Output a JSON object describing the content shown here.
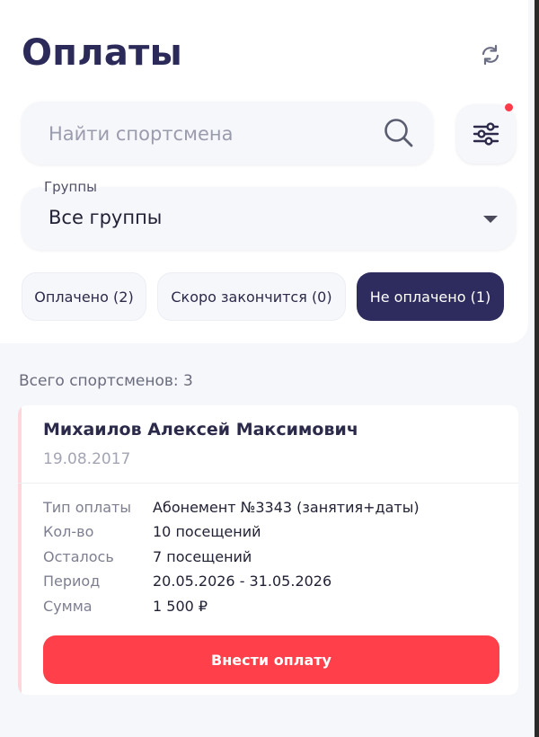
{
  "header": {
    "title": "Оплаты",
    "refresh_icon": "refresh-icon"
  },
  "search": {
    "placeholder": "Найти спортсмена",
    "value": "",
    "icon": "search-icon"
  },
  "filter_button": {
    "icon": "sliders-icon",
    "has_badge": true,
    "badge_color": "#ff3b4a"
  },
  "groups": {
    "label": "Группы",
    "selected": "Все группы"
  },
  "status_tabs": [
    {
      "label": "Оплачено (2)",
      "active": false
    },
    {
      "label": "Скоро закончится (0)",
      "active": false
    },
    {
      "label": "Не оплачено (1)",
      "active": true
    }
  ],
  "summary": {
    "total_text": "Всего спортсменов: 3"
  },
  "athlete_card": {
    "name": "Михаилов Алексей Максимович",
    "birth_date": "19.08.2017",
    "details": [
      {
        "label": "Тип оплаты",
        "value": "Абонемент №3343 (занятия+даты)"
      },
      {
        "label": "Кол-во",
        "value": "10 посещений"
      },
      {
        "label": "Осталось",
        "value": "7 посещений"
      },
      {
        "label": "Период",
        "value": "20.05.2026 - 31.05.2026"
      },
      {
        "label": "Сумма",
        "value": "1 500 ₽"
      }
    ],
    "pay_button": "Внести оплату"
  },
  "colors": {
    "accent_dark": "#2e2c5e",
    "accent_red": "#ff3f49",
    "background": "#f6f7fb",
    "card_stripe": "#ffd7da"
  }
}
